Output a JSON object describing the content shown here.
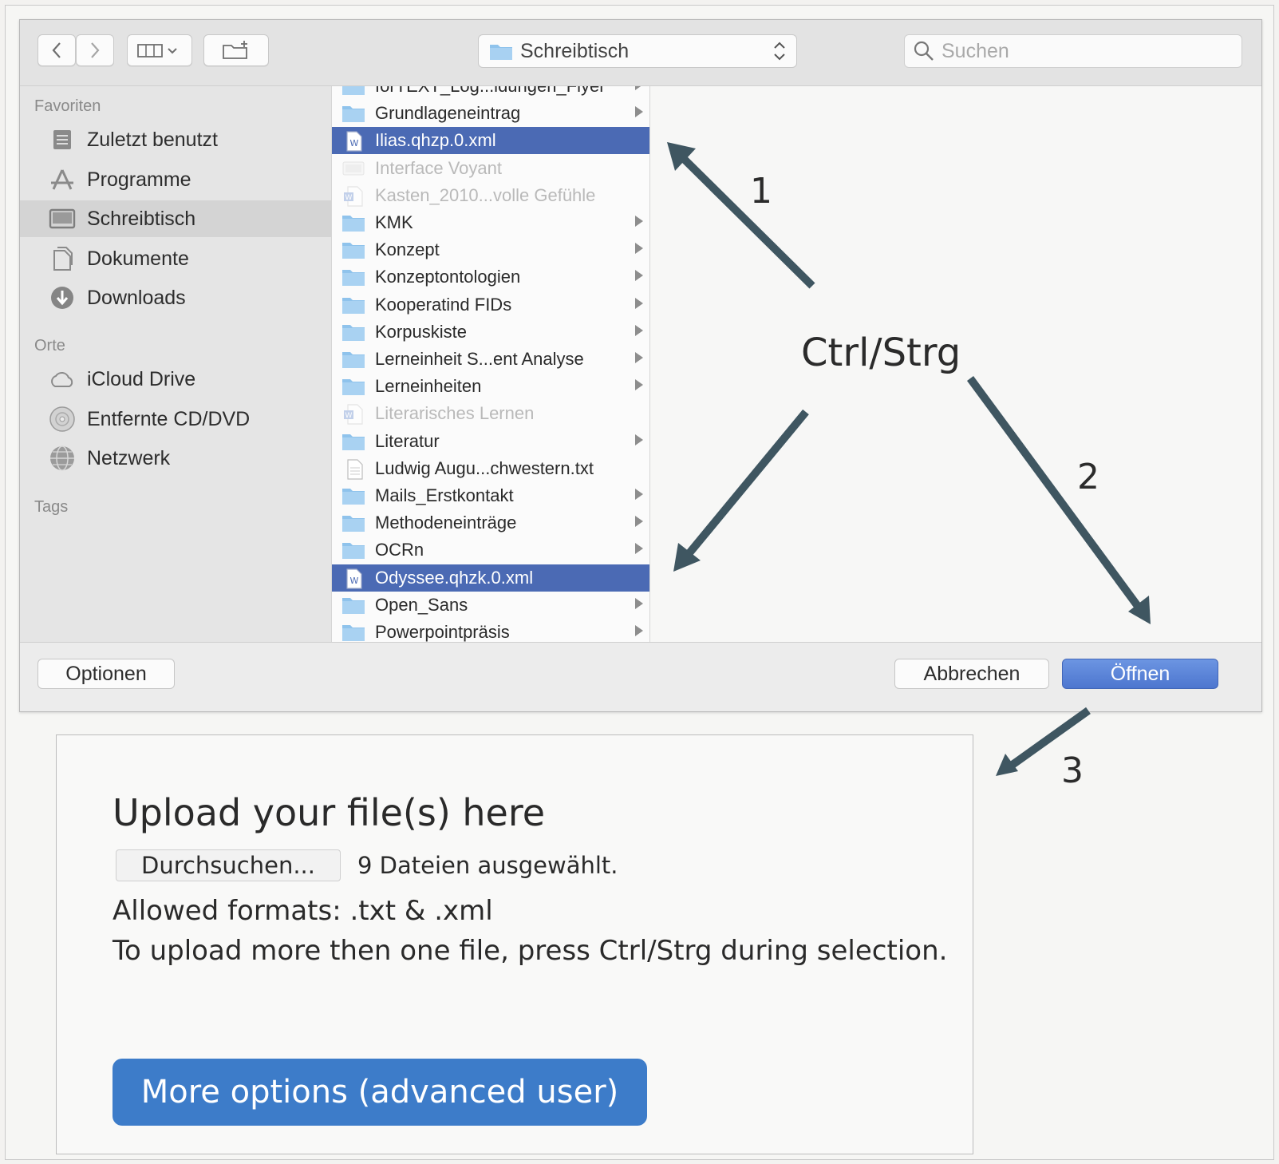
{
  "dialog": {
    "toolbar": {
      "location": "Schreibtisch",
      "search_placeholder": "Suchen"
    },
    "sidebar": {
      "favorites_heading": "Favoriten",
      "favorites": [
        "Zuletzt benutzt",
        "Programme",
        "Schreibtisch",
        "Dokumente",
        "Downloads"
      ],
      "places_heading": "Orte",
      "places": [
        "iCloud Drive",
        "Entfernte CD/DVD",
        "Netzwerk"
      ],
      "tags_heading": "Tags"
    },
    "files": [
      {
        "name": "forTEXT_Log...ldungen_Flyer",
        "kind": "folder"
      },
      {
        "name": "Grundlageneintrag",
        "kind": "folder"
      },
      {
        "name": "Ilias.qhzp.0.xml",
        "kind": "xml",
        "selected": true
      },
      {
        "name": "Interface Voyant",
        "kind": "file",
        "disabled": true
      },
      {
        "name": "Kasten_2010...volle Gefühle",
        "kind": "word",
        "disabled": true
      },
      {
        "name": "KMK",
        "kind": "folder"
      },
      {
        "name": "Konzept",
        "kind": "folder"
      },
      {
        "name": "Konzeptontologien",
        "kind": "folder"
      },
      {
        "name": "Kooperatind FIDs",
        "kind": "folder"
      },
      {
        "name": "Korpuskiste",
        "kind": "folder"
      },
      {
        "name": "Lerneinheit S...ent Analyse",
        "kind": "folder"
      },
      {
        "name": "Lerneinheiten",
        "kind": "folder"
      },
      {
        "name": "Literarisches Lernen",
        "kind": "word",
        "disabled": true
      },
      {
        "name": "Literatur",
        "kind": "folder"
      },
      {
        "name": "Ludwig Augu...chwestern.txt",
        "kind": "txt"
      },
      {
        "name": "Mails_Erstkontakt",
        "kind": "folder"
      },
      {
        "name": "Methodeneinträge",
        "kind": "folder"
      },
      {
        "name": "OCRn",
        "kind": "folder"
      },
      {
        "name": "Odyssee.qhzk.0.xml",
        "kind": "xml",
        "selected": true
      },
      {
        "name": "Open_Sans",
        "kind": "folder"
      },
      {
        "name": "Powerpointpräsis",
        "kind": "folder"
      }
    ],
    "buttons": {
      "options": "Optionen",
      "cancel": "Abbrechen",
      "open": "Öffnen"
    }
  },
  "annotations": {
    "step1": "1",
    "step2": "2",
    "step3": "3",
    "modifier": "Ctrl/Strg"
  },
  "upload": {
    "title": "Upload your file(s) here",
    "browse_label": "Durchsuchen...",
    "selected_files": "9 Dateien ausgewählt.",
    "formats": "Allowed formats: .txt & .xml",
    "hint": "To upload more then one file, press Ctrl/Strg during selection.",
    "more_options": "More options (advanced user)"
  },
  "colors": {
    "selection": "#4b6ab4",
    "primary_button": "#4d76cf",
    "more_options_button": "#3d7cc9",
    "arrow": "#3f5661",
    "folder": "#8fc3ec"
  }
}
